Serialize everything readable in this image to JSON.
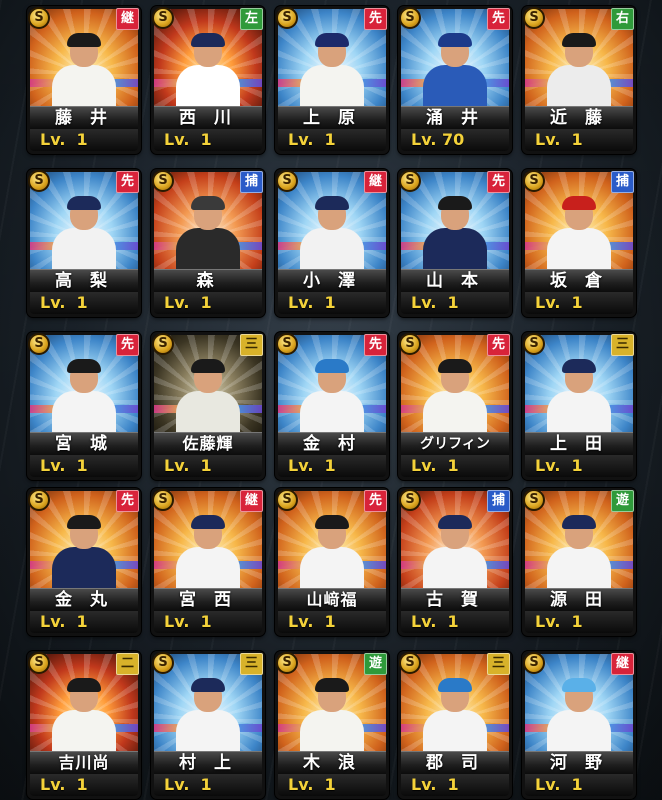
{
  "cards": [
    {
      "name": "藤 井",
      "level": "Lv.  1",
      "position": "継",
      "pos_color": "red",
      "theme": "gold",
      "uniform": "#f4f4f0",
      "cap": "#1a1a1a",
      "coin": "S"
    },
    {
      "name": "西 川",
      "level": "Lv.  1",
      "position": "左",
      "pos_color": "green",
      "theme": "fire",
      "uniform": "#ffffff",
      "cap": "#1c2a5a",
      "coin": "S"
    },
    {
      "name": "上 原",
      "level": "Lv.  1",
      "position": "先",
      "pos_color": "red",
      "theme": "blue",
      "uniform": "#f4f4f0",
      "cap": "#1c2a6a",
      "coin": "S"
    },
    {
      "name": "涌 井",
      "level": "Lv. 70",
      "position": "先",
      "pos_color": "red",
      "theme": "blue",
      "uniform": "#2a5bb8",
      "cap": "#1c3a8a",
      "coin": "S"
    },
    {
      "name": "近 藤",
      "level": "Lv.  1",
      "position": "右",
      "pos_color": "green",
      "theme": "gold",
      "uniform": "#ececec",
      "cap": "#1a1a1a",
      "coin": "S"
    },
    {
      "name": "高 梨",
      "level": "Lv.  1",
      "position": "先",
      "pos_color": "red",
      "theme": "blue",
      "uniform": "#f2f2f2",
      "cap": "#1c2a5a",
      "coin": "S"
    },
    {
      "name": "森",
      "level": "Lv.  1",
      "position": "捕",
      "pos_color": "blue",
      "theme": "red",
      "uniform": "#2a2a2a",
      "cap": "#3a3a3a",
      "coin": "S"
    },
    {
      "name": "小 澤",
      "level": "Lv.  1",
      "position": "継",
      "pos_color": "red",
      "theme": "blue",
      "uniform": "#f2f2f2",
      "cap": "#1c2a5a",
      "coin": "S"
    },
    {
      "name": "山 本",
      "level": "Lv.  1",
      "position": "先",
      "pos_color": "red",
      "theme": "blue",
      "uniform": "#1c2a5a",
      "cap": "#1a1a1a",
      "coin": "S"
    },
    {
      "name": "坂 倉",
      "level": "Lv.  1",
      "position": "捕",
      "pos_color": "blue",
      "theme": "gold",
      "uniform": "#f4f4f4",
      "cap": "#c8201c",
      "coin": "S"
    },
    {
      "name": "宮 城",
      "level": "Lv.  1",
      "position": "先",
      "pos_color": "red",
      "theme": "blue",
      "uniform": "#f4f4f4",
      "cap": "#1a1a1a",
      "coin": "S"
    },
    {
      "name": "佐藤輝",
      "level": "Lv.  1",
      "position": "三",
      "pos_color": "yellow",
      "theme": "dark",
      "uniform": "#e8e8e0",
      "cap": "#1a1a1a",
      "coin": "S"
    },
    {
      "name": "金 村",
      "level": "Lv.  1",
      "position": "先",
      "pos_color": "red",
      "theme": "blue",
      "uniform": "#f4f4f4",
      "cap": "#2a7ac8",
      "coin": "S"
    },
    {
      "name": "グリフィン",
      "level": "Lv.  1",
      "position": "先",
      "pos_color": "red",
      "theme": "gold",
      "uniform": "#f4f4f0",
      "cap": "#1a1a1a",
      "coin": "S"
    },
    {
      "name": "上 田",
      "level": "Lv.  1",
      "position": "三",
      "pos_color": "yellow",
      "theme": "blue",
      "uniform": "#f4f4f4",
      "cap": "#1c2a5a",
      "coin": "S"
    },
    {
      "name": "金 丸",
      "level": "Lv.  1",
      "position": "先",
      "pos_color": "red",
      "theme": "gold",
      "uniform": "#1c2a5a",
      "cap": "#1a1a1a",
      "coin": "S"
    },
    {
      "name": "宮 西",
      "level": "Lv.  1",
      "position": "継",
      "pos_color": "red",
      "theme": "gold",
      "uniform": "#f4f4f4",
      "cap": "#1c2a5a",
      "coin": "S"
    },
    {
      "name": "山﨑福",
      "level": "Lv.  1",
      "position": "先",
      "pos_color": "red",
      "theme": "gold",
      "uniform": "#f4f4f4",
      "cap": "#1a1a1a",
      "coin": "S"
    },
    {
      "name": "古 賀",
      "level": "Lv.  1",
      "position": "捕",
      "pos_color": "blue",
      "theme": "red",
      "uniform": "#f4f4f4",
      "cap": "#1c2a5a",
      "coin": "S"
    },
    {
      "name": "源 田",
      "level": "Lv.  1",
      "position": "遊",
      "pos_color": "green",
      "theme": "gold",
      "uniform": "#f4f4f4",
      "cap": "#1c2a5a",
      "coin": "S"
    },
    {
      "name": "吉川尚",
      "level": "Lv.  1",
      "position": "二",
      "pos_color": "yellow",
      "theme": "fire",
      "uniform": "#f4f4f0",
      "cap": "#1a1a1a",
      "coin": "S"
    },
    {
      "name": "村 上",
      "level": "Lv.  1",
      "position": "三",
      "pos_color": "yellow",
      "theme": "blue",
      "uniform": "#f4f4f4",
      "cap": "#1c2a5a",
      "coin": "S"
    },
    {
      "name": "木 浪",
      "level": "Lv.  1",
      "position": "遊",
      "pos_color": "green",
      "theme": "gold",
      "uniform": "#f4f4f0",
      "cap": "#1a1a1a",
      "coin": "S"
    },
    {
      "name": "郡 司",
      "level": "Lv.  1",
      "position": "三",
      "pos_color": "yellow",
      "theme": "gold",
      "uniform": "#f4f4f4",
      "cap": "#2a7ac8",
      "coin": "S"
    },
    {
      "name": "河 野",
      "level": "Lv.  1",
      "position": "継",
      "pos_color": "red",
      "theme": "blue",
      "uniform": "#f4f4f4",
      "cap": "#5ab0e8",
      "coin": "S"
    }
  ]
}
